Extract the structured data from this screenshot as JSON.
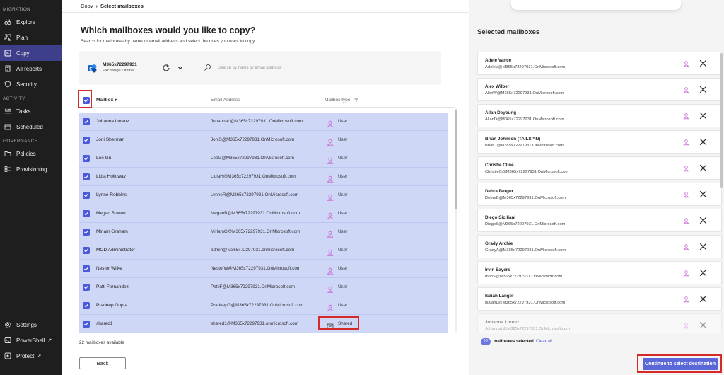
{
  "sidebar": {
    "sections": [
      {
        "label": "MIGRATION",
        "items": [
          {
            "label": "Explore",
            "icon": "binoculars-icon"
          },
          {
            "label": "Plan",
            "icon": "plan-icon"
          },
          {
            "label": "Copy",
            "icon": "copy-icon",
            "active": true
          },
          {
            "label": "All reports",
            "icon": "reports-icon"
          },
          {
            "label": "Security",
            "icon": "shield-icon"
          }
        ]
      },
      {
        "label": "ACTIVITY",
        "items": [
          {
            "label": "Tasks",
            "icon": "tasks-icon"
          },
          {
            "label": "Scheduled",
            "icon": "calendar-icon"
          }
        ]
      },
      {
        "label": "GOVERNANCE",
        "items": [
          {
            "label": "Policies",
            "icon": "folder-icon"
          },
          {
            "label": "Provisioning",
            "icon": "provisioning-icon"
          }
        ]
      }
    ],
    "bottom": [
      {
        "label": "Settings",
        "icon": "gear-icon"
      },
      {
        "label": "PowerShell",
        "icon": "terminal-icon",
        "external": "↗"
      },
      {
        "label": "Protect",
        "icon": "protect-icon",
        "external": "↗"
      }
    ],
    "accent": "#3d3f8a"
  },
  "breadcrumb": {
    "parent": "Copy",
    "separator": "›",
    "current": "Select mailboxes"
  },
  "page": {
    "title": "Which mailboxes would you like to copy?",
    "subtitle": "Search for mailboxes by name or email address and select the ones you want to copy."
  },
  "source": {
    "name": "M365x72297931",
    "type": "Exchange Online",
    "icon": "exchange-icon"
  },
  "search": {
    "placeholder": "Search by name or email address",
    "value": ""
  },
  "table": {
    "columns": {
      "mailbox": "Mailbox",
      "email": "Email Address",
      "type": "Mailbox type"
    },
    "sort_icon": "chevron-down-icon",
    "filter_icon": "filter-icon",
    "rows": [
      {
        "name": "Johanna Lorenz",
        "email": "JohannaL@M365x72297931.OnMicrosoft.com",
        "type": "User",
        "icon": "user-icon"
      },
      {
        "name": "Joni Sherman",
        "email": "JoniS@M365x72297931.OnMicrosoft.com",
        "type": "User",
        "icon": "user-icon"
      },
      {
        "name": "Lee Gu",
        "email": "LeeG@M365x72297931.OnMicrosoft.com",
        "type": "User",
        "icon": "user-icon"
      },
      {
        "name": "Lidia Holloway",
        "email": "LidiaH@M365x72297931.OnMicrosoft.com",
        "type": "User",
        "icon": "user-icon"
      },
      {
        "name": "Lynne Robbins",
        "email": "LynneR@M365x72297931.OnMicrosoft.com",
        "type": "User",
        "icon": "user-icon"
      },
      {
        "name": "Megan Bowen",
        "email": "MeganB@M365x72297931.OnMicrosoft.com",
        "type": "User",
        "icon": "user-icon"
      },
      {
        "name": "Miriam Graham",
        "email": "MiriamG@M365x72297931.OnMicrosoft.com",
        "type": "User",
        "icon": "user-icon"
      },
      {
        "name": "MOD Administrator",
        "email": "admin@M365x72297931.onmicrosoft.com",
        "type": "User",
        "icon": "user-icon"
      },
      {
        "name": "Nestor Wilke",
        "email": "NestorW@M365x72297931.OnMicrosoft.com",
        "type": "User",
        "icon": "user-icon"
      },
      {
        "name": "Patti Fernandez",
        "email": "PattiF@M365x72297931.OnMicrosoft.com",
        "type": "User",
        "icon": "user-icon"
      },
      {
        "name": "Pradeep Gupta",
        "email": "PradeepG@M365x72297931.OnMicrosoft.com",
        "type": "User",
        "icon": "user-icon"
      },
      {
        "name": "shared1",
        "email": "shared1@M365x72297931.onmicrosoft.com",
        "type": "Shared",
        "icon": "shared-mailbox-icon"
      }
    ]
  },
  "available_text": "22 mailboxes available",
  "back_label": "Back",
  "right_panel": {
    "title": "Selected mailboxes",
    "items": [
      {
        "name": "Adele Vance",
        "email": "AdeleV@M365x72297931.OnMicrosoft.com"
      },
      {
        "name": "Alex Wilber",
        "email": "AlexW@M365x72297931.OnMicrosoft.com"
      },
      {
        "name": "Allan Deyoung",
        "email": "AllanD@M365x72297931.OnMicrosoft.com"
      },
      {
        "name": "Brian Johnson (TAILSPIN)",
        "email": "BrianJ@M365x72297931.OnMicrosoft.com"
      },
      {
        "name": "Christie Cline",
        "email": "ChristieC@M365x72297931.OnMicrosoft.com"
      },
      {
        "name": "Debra Berger",
        "email": "DebraB@M365x72297931.OnMicrosoft.com"
      },
      {
        "name": "Diego Siciliani",
        "email": "DiegoS@M365x72297931.OnMicrosoft.com"
      },
      {
        "name": "Grady Archie",
        "email": "GradyA@M365x72297931.OnMicrosoft.com"
      },
      {
        "name": "Irvin Sayers",
        "email": "IrvinS@M365x72297931.OnMicrosoft.com"
      },
      {
        "name": "Isaiah Langer",
        "email": "IsaiahL@M365x72297931.OnMicrosoft.com"
      },
      {
        "name": "Johanna Lorenz",
        "email": "JohannaL@M365x72297931.OnMicrosoft.com"
      }
    ],
    "count": "22",
    "count_text": "mailboxes selected",
    "clear_all": "Clear all",
    "continue_label": "Continue to select destination"
  },
  "colors": {
    "accent": "#4a5ad9",
    "row_selected": "#cfd7f7",
    "highlight": "#d42a2a",
    "user_icon": "#c970d6"
  }
}
